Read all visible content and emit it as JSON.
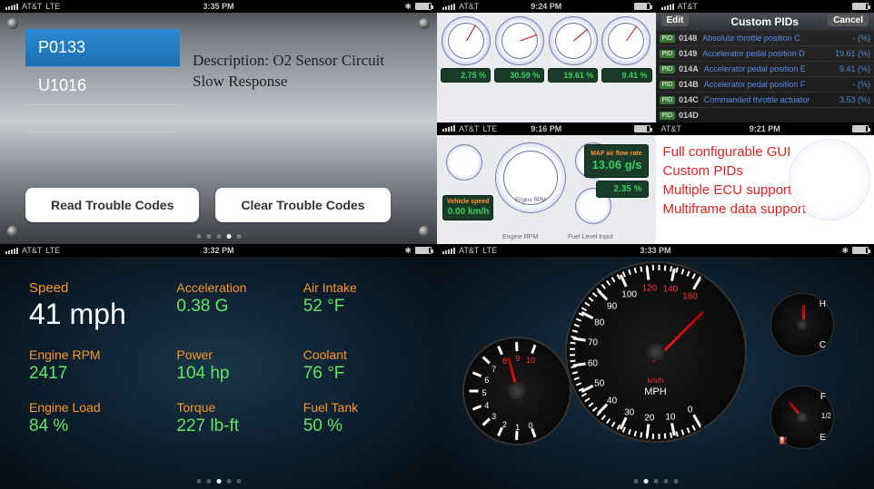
{
  "status_bars": {
    "carrier": "AT&T",
    "network": "LTE",
    "p1_time": "3:35 PM",
    "p2a_time": "9:24 PM",
    "p2b_time": "9:16 PM",
    "p2c_time": "",
    "p2d_time": "9:21 PM",
    "p3_time": "3:32 PM",
    "p4_time": "3:33 PM"
  },
  "p1": {
    "codes": [
      "P0133",
      "U1016"
    ],
    "description": "Description: O2 Sensor Circuit Slow Response",
    "read_btn": "Read Trouble Codes",
    "clear_btn": "Clear Trouble Codes"
  },
  "p2": {
    "gauge_vals1": [
      "2.75 %",
      "30.59 %",
      "19.61 %",
      "9.41 %"
    ],
    "pids_title": "Custom PIDs",
    "edit": "Edit",
    "cancel": "Cancel",
    "pids": [
      {
        "code": "0148",
        "name": "Absolute throttle position C",
        "val": "- (%)"
      },
      {
        "code": "0149",
        "name": "Accelerator pedal position D",
        "val": "19.61 (%)"
      },
      {
        "code": "014A",
        "name": "Accelerator pedal position E",
        "val": "9.41 (%)"
      },
      {
        "code": "014B",
        "name": "Accelerator pedal position F",
        "val": "- (%)"
      },
      {
        "code": "014C",
        "name": "Commanded throttle actuator",
        "val": "3.53 (%)"
      },
      {
        "code": "014D",
        "name": "",
        "val": ""
      }
    ],
    "gauges2": {
      "speed_lbl": "Vehicle speed",
      "speed_val": "0.00 km/h",
      "maf_lbl": "MAF air flow rate",
      "maf_val": "13.06 g/s",
      "scnd_val": "2.35 %",
      "rpm_lbl": "Engine RPM",
      "fuel_lbl": "Fuel Level Input"
    },
    "features": [
      "Full configurable GUI",
      "Custom PIDs",
      "Multiple ECU support",
      "Multiframe data support"
    ]
  },
  "p3": {
    "metrics": [
      {
        "lbl": "Speed",
        "val": "41 mph"
      },
      {
        "lbl": "Acceleration",
        "val": "0.38 G"
      },
      {
        "lbl": "Air Intake",
        "val": "52 °F"
      },
      {
        "lbl": "Engine RPM",
        "val": "2417"
      },
      {
        "lbl": "Power",
        "val": "104 hp"
      },
      {
        "lbl": "Coolant",
        "val": "76 °F"
      },
      {
        "lbl": "Engine Load",
        "val": "84 %"
      },
      {
        "lbl": "Torque",
        "val": "227 lb-ft"
      },
      {
        "lbl": "Fuel Tank",
        "val": "50 %"
      }
    ]
  },
  "p4": {
    "speedo_unit": "MPH",
    "speedo_unit2": "km/h",
    "temp_h": "H",
    "temp_c": "C",
    "fuel_f": "F",
    "fuel_e": "E",
    "fuel_half": "1/2",
    "speedo_ticks": [
      "0",
      "10",
      "20",
      "30",
      "40",
      "50",
      "60",
      "70",
      "80",
      "90",
      "100",
      "120",
      "140",
      "160"
    ],
    "tach_ticks": [
      "0",
      "1",
      "2",
      "3",
      "4",
      "5",
      "6",
      "7",
      "8",
      "9",
      "10"
    ]
  }
}
